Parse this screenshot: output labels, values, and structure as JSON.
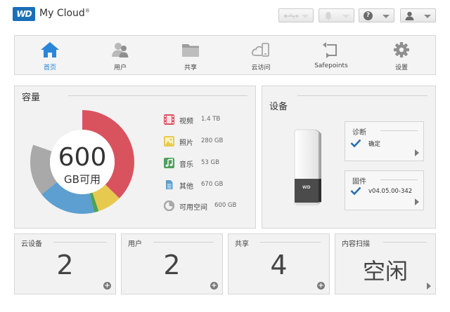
{
  "header": {
    "logo_text": "WD",
    "app_name": "My Cloud",
    "trademark": "®"
  },
  "nav": {
    "items": [
      {
        "label": "首页",
        "icon": "home-icon",
        "active": true
      },
      {
        "label": "用户",
        "icon": "users-icon",
        "active": false
      },
      {
        "label": "共享",
        "icon": "folder-icon",
        "active": false
      },
      {
        "label": "云访问",
        "icon": "cloud-access-icon",
        "active": false
      },
      {
        "label": "Safepoints",
        "icon": "safepoints-icon",
        "active": false
      },
      {
        "label": "设置",
        "icon": "gear-icon",
        "active": false
      }
    ]
  },
  "capacity": {
    "title": "容量",
    "free_value": "600",
    "free_unit": "GB可用",
    "colors": {
      "video": "#d9535f",
      "photo": "#e8c94f",
      "music": "#4ea15a",
      "other": "#5d9fd0",
      "free": "#a9a9a9"
    },
    "legend": [
      {
        "name": "视频",
        "value": "1.4 TB",
        "key": "video"
      },
      {
        "name": "照片",
        "value": "280 GB",
        "key": "photo"
      },
      {
        "name": "音乐",
        "value": "53 GB",
        "key": "music"
      },
      {
        "name": "其他",
        "value": "670 GB",
        "key": "other"
      },
      {
        "name": "可用空间",
        "value": "600 GB",
        "key": "free"
      }
    ]
  },
  "device": {
    "title": "设备",
    "diagnostics": {
      "title": "诊断",
      "status": "确定"
    },
    "firmware": {
      "title": "固件",
      "version": "v04.05.00-342"
    }
  },
  "stats": [
    {
      "title": "云设备",
      "value": "2"
    },
    {
      "title": "用户",
      "value": "2"
    },
    {
      "title": "共享",
      "value": "4"
    },
    {
      "title": "内容扫描",
      "value": "空闲"
    }
  ]
}
